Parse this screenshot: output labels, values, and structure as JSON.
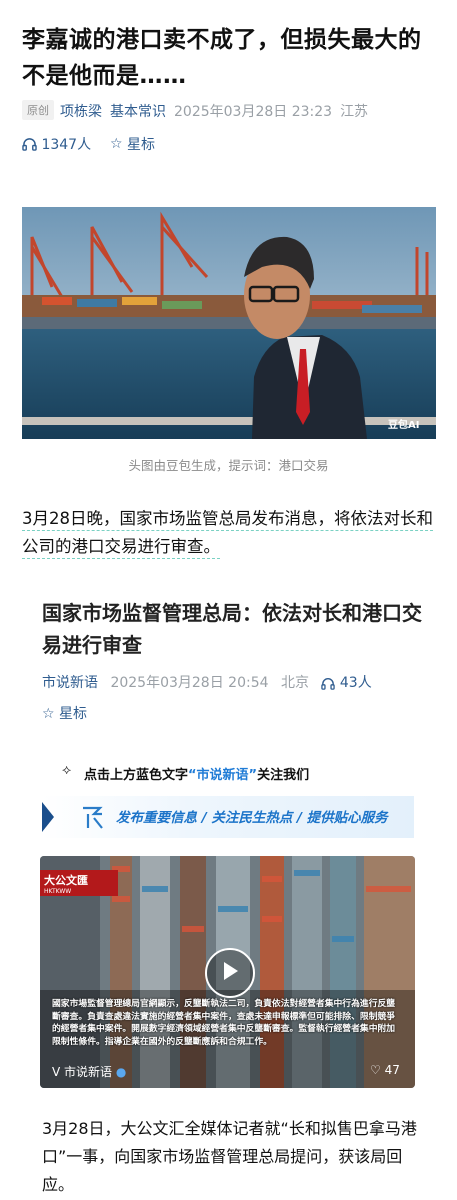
{
  "article": {
    "title": "李嘉诚的港口卖不成了，但损失最大的不是他而是……",
    "badge": "原创",
    "author": "项栋梁",
    "column": "基本常识",
    "date": "2025年03月28日 23:23",
    "location": "江苏",
    "listeners": "1347人",
    "star_label": "星标"
  },
  "hero": {
    "image_label": "豆包AI",
    "caption": "头图由豆包生成，提示词：港口交易"
  },
  "paragraph1": "3月28日晚，国家市场监管总局发布消息，将依法对长和公司的港口交易进行审查。",
  "embedded": {
    "title": "国家市场监督管理总局：依法对长和港口交易进行审查",
    "source": "市说新语",
    "date": "2025年03月28日 20:54",
    "location": "北京",
    "listeners": "43人",
    "star_label": "星标",
    "follow_prefix": "点击上方蓝色文字",
    "follow_link": "“市说新语”",
    "follow_suffix": "关注我们",
    "banner_slogan": "发布重要信息 / 关注民生热点 / 提供贴心服务",
    "video": {
      "logo_text": "大公文匯",
      "logo_sub": "HKTKWW",
      "overlay_text": "國家市場監督管理總局官網顯示，反壟斷執法二司，負責依法對經營者集中行為進行反壟斷審查。負責查處違法實施的經營者集中案件，查處未達申報標準但可能排除、限制競爭的經營者集中案件。開展數字經濟領域經營者集中反壟斷審查。監督執行經營者集中附加限制性條件。指導企業在國外的反壟斷應訴和合規工作。",
      "channel": "市说新语",
      "likes": "47"
    }
  },
  "paragraph2": "3月28日，大公文汇全媒体记者就“长和拟售巴拿马港口”一事，向国家市场监督管理总局提问，获该局回应。"
}
